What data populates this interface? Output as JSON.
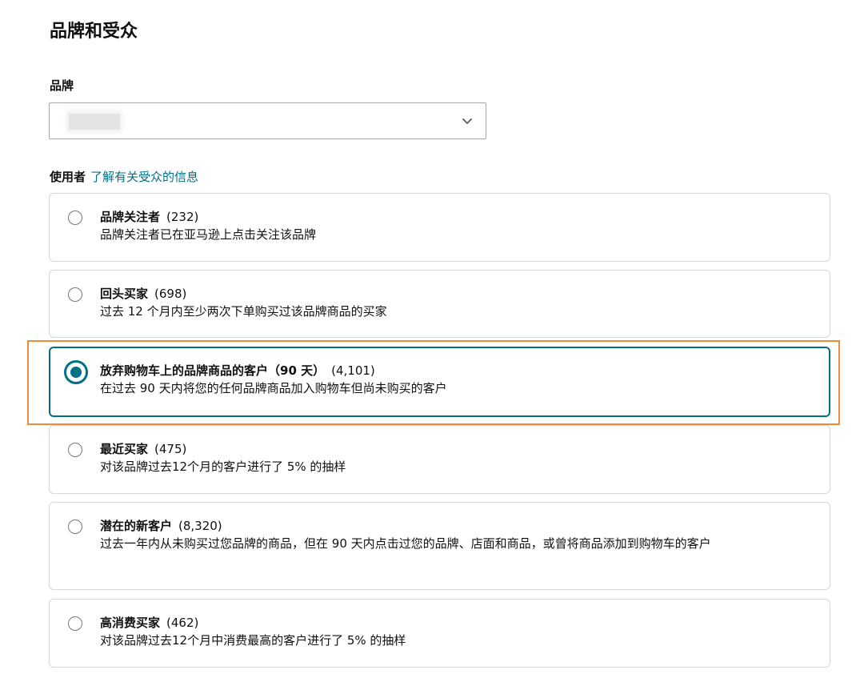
{
  "section_title": "品牌和受众",
  "brand": {
    "label": "品牌"
  },
  "audience": {
    "label": "使用者",
    "learn_link": "了解有关受众的信息",
    "options": [
      {
        "name": "品牌关注者",
        "count": "(232)",
        "description": "品牌关注者已在亚马逊上点击关注该品牌",
        "selected": false
      },
      {
        "name": "回头买家",
        "count": "(698)",
        "description": "过去 12 个月内至少两次下单购买过该品牌商品的买家",
        "selected": false
      },
      {
        "name": "放弃购物车上的品牌商品的客户（90 天）",
        "count": "(4,101)",
        "description": "在过去 90 天内将您的任何品牌商品加入购物车但尚未购买的客户",
        "selected": true
      },
      {
        "name": "最近买家",
        "count": "(475)",
        "description": "对该品牌过去12个月的客户进行了 5% 的抽样",
        "selected": false
      },
      {
        "name": "潜在的新客户",
        "count": "(8,320)",
        "description": "过去一年内从未购买过您品牌的商品，但在 90 天内点击过您的品牌、店面和商品，或曾将商品添加到购物车的客户",
        "selected": false
      },
      {
        "name": "高消费买家",
        "count": "(462)",
        "description": "对该品牌过去12个月中消费最高的客户进行了 5% 的抽样",
        "selected": false
      }
    ]
  },
  "colors": {
    "accent": "#007185",
    "highlight": "#ef8a3a",
    "border": "#d5d9d9",
    "text": "#0f1111"
  }
}
